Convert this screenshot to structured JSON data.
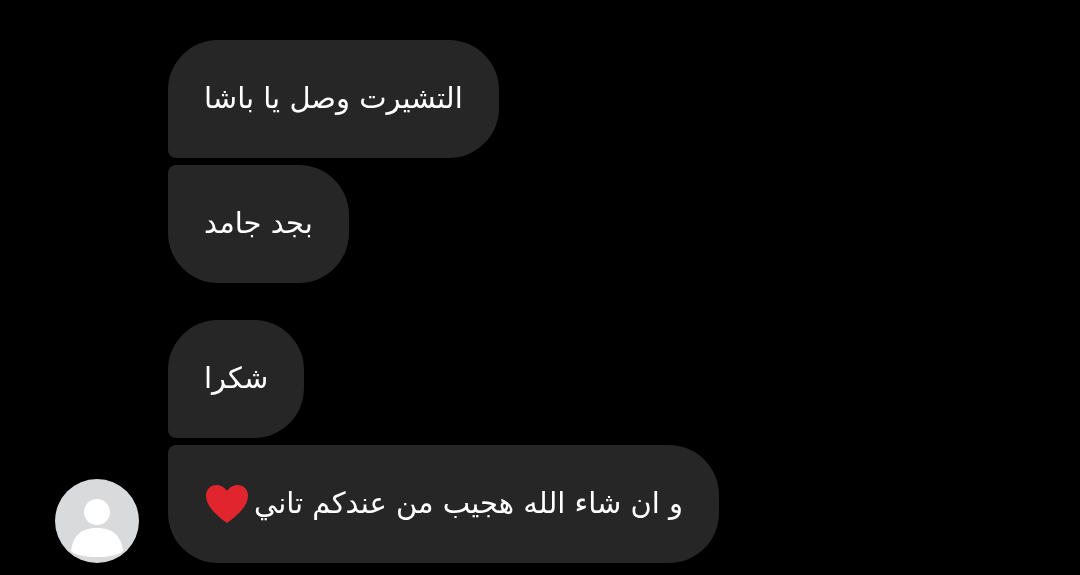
{
  "message_groups": [
    {
      "show_avatar": false,
      "messages": [
        {
          "text": "التشيرت وصل يا باشا",
          "heart": false
        },
        {
          "text": "بجد جامد",
          "heart": false
        }
      ]
    },
    {
      "show_avatar": true,
      "messages": [
        {
          "text": "شكرا",
          "heart": false
        },
        {
          "text": "و ان شاء الله هجيب من عندكم تاني",
          "heart": true
        }
      ]
    }
  ]
}
